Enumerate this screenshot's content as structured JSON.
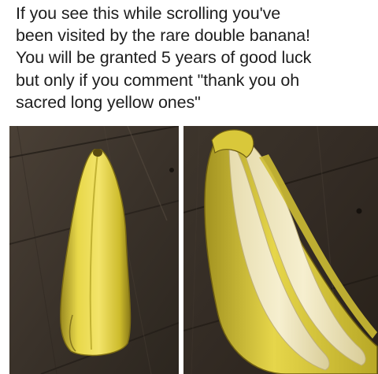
{
  "caption": {
    "lines": [
      "If you see this while scrolling you've",
      "been visited by the rare double banana!",
      "You will be granted 5 years of good luck",
      "but only if you comment \"thank you oh",
      "sacred long yellow ones\""
    ]
  },
  "photos": [
    {
      "subject": "closed-banana-peel-on-wood-floor"
    },
    {
      "subject": "opened-banana-with-two-fruits-on-wood-floor"
    }
  ]
}
